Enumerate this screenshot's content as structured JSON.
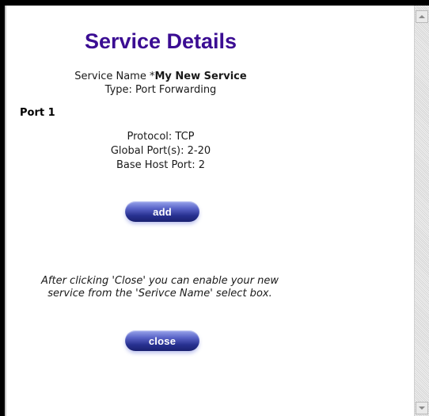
{
  "page": {
    "title": "Service Details",
    "service_name_label": "Service Name *",
    "service_name_value": "My New Service",
    "type_text": "Type: Port Forwarding",
    "port_heading": "Port 1",
    "protocol_text": "Protocol: TCP",
    "global_ports_text": "Global Port(s): 2-20",
    "base_host_port_text": "Base Host Port: 2",
    "add_label": "add",
    "note_text": "After clicking 'Close' you can enable your new service from the 'Serivce Name' select box.",
    "close_label": "close"
  },
  "colors": {
    "title": "#3b0d93",
    "button": "#27308f"
  }
}
